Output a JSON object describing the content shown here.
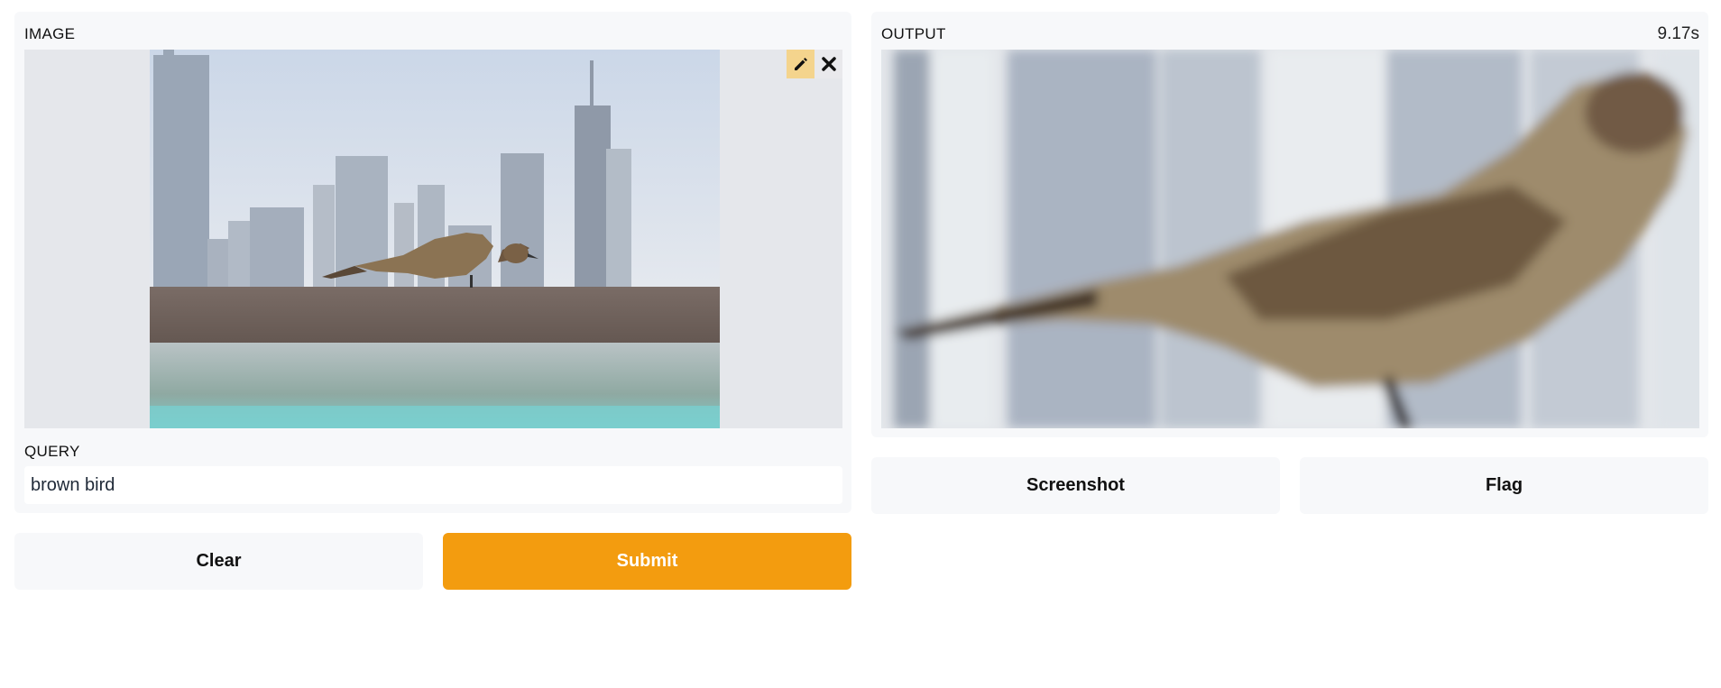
{
  "input_panel": {
    "image_label": "IMAGE",
    "query_label": "QUERY",
    "query_value": "brown bird",
    "image_subject": "bird perched on a railing in front of city skyline"
  },
  "output_panel": {
    "label": "OUTPUT",
    "timer": "9.17s",
    "image_subject": "zoomed crop of the brown bird"
  },
  "buttons": {
    "clear": "Clear",
    "submit": "Submit",
    "screenshot": "Screenshot",
    "flag": "Flag"
  },
  "icons": {
    "edit": "pencil-icon",
    "close": "close-icon"
  },
  "colors": {
    "accent": "#f39c0f",
    "panel_bg": "#f7f8fa",
    "edit_tool_bg": "#f4d48d"
  }
}
